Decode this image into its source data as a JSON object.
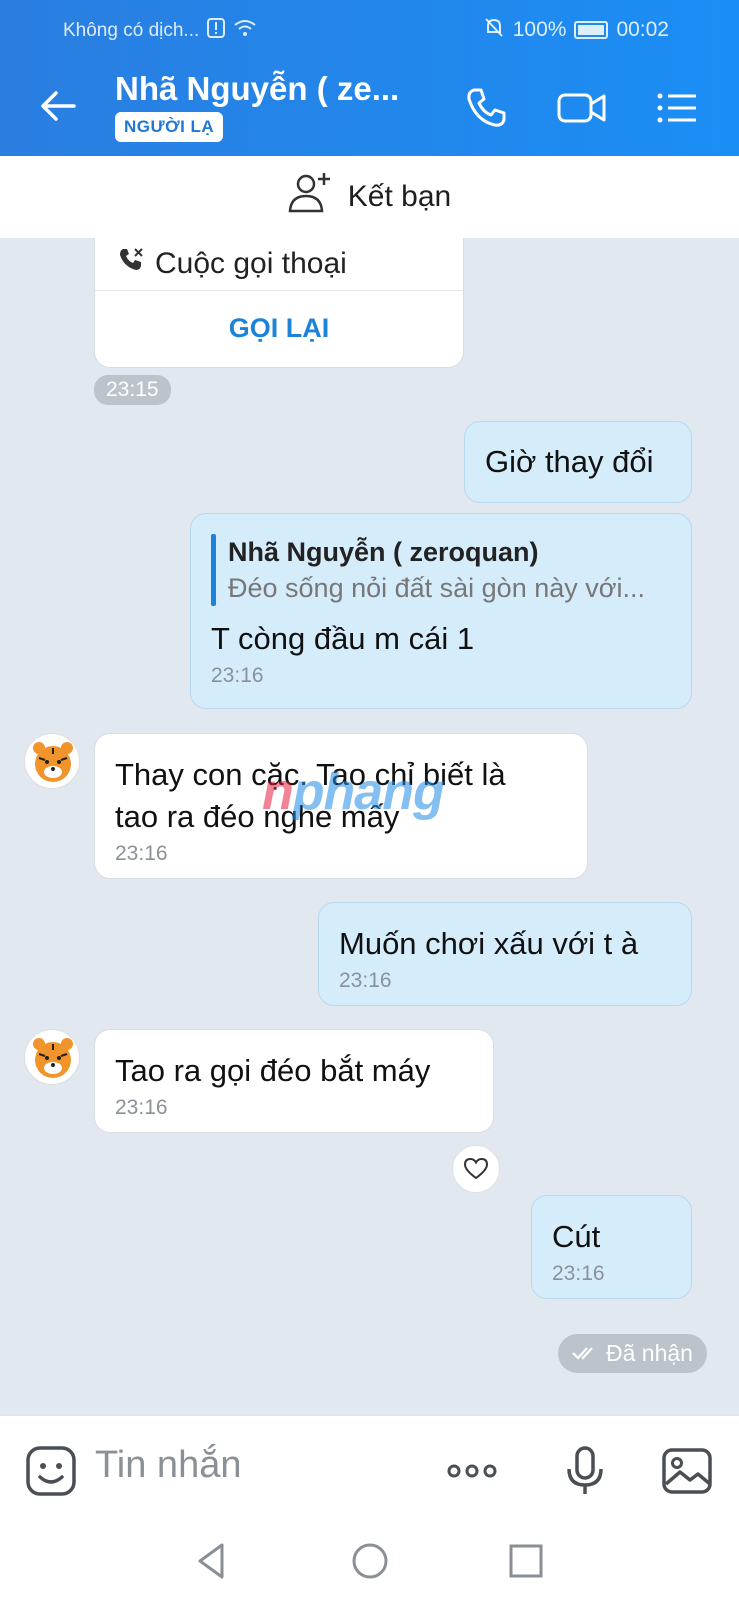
{
  "status_bar": {
    "carrier": "Không có dịch...",
    "battery": "100%",
    "time": "00:02"
  },
  "header": {
    "title": "Nhã Nguyễn ( ze...",
    "badge": "NGƯỜI LẠ"
  },
  "friend_bar": {
    "label": "Kết bạn"
  },
  "call_card": {
    "label": "Cuộc gọi thoại",
    "action": "GỌI LẠI",
    "time": "23:15"
  },
  "messages": [
    {
      "side": "out",
      "text": "Giờ thay đổi"
    },
    {
      "side": "out",
      "quote_name": "Nhã Nguyễn ( zeroquan)",
      "quote_text": "Đéo sống nỏi đất sài gòn này với...",
      "text": "T còng đầu m cái 1",
      "time": "23:16"
    },
    {
      "side": "in",
      "text_line1": "Thay con cặc. Tao chỉ biết là",
      "text_line2": "tao ra đéo nghe mấy",
      "time": "23:16"
    },
    {
      "side": "out",
      "text": "Muốn chơi xấu với t à",
      "time": "23:16"
    },
    {
      "side": "in",
      "text": "Tao ra gọi đéo bắt máy",
      "time": "23:16"
    },
    {
      "side": "out",
      "text": "Cút",
      "time": "23:16"
    }
  ],
  "delivery_status": "Đã nhận",
  "watermark": {
    "part1": "n",
    "part2": "phang"
  },
  "input": {
    "placeholder": "Tin nhắn"
  },
  "colors": {
    "header": "#1b8ef5",
    "outgoing": "#d5ecfb",
    "incoming": "#ffffff",
    "background": "#e2e8ef",
    "accent": "#1c84d8"
  }
}
